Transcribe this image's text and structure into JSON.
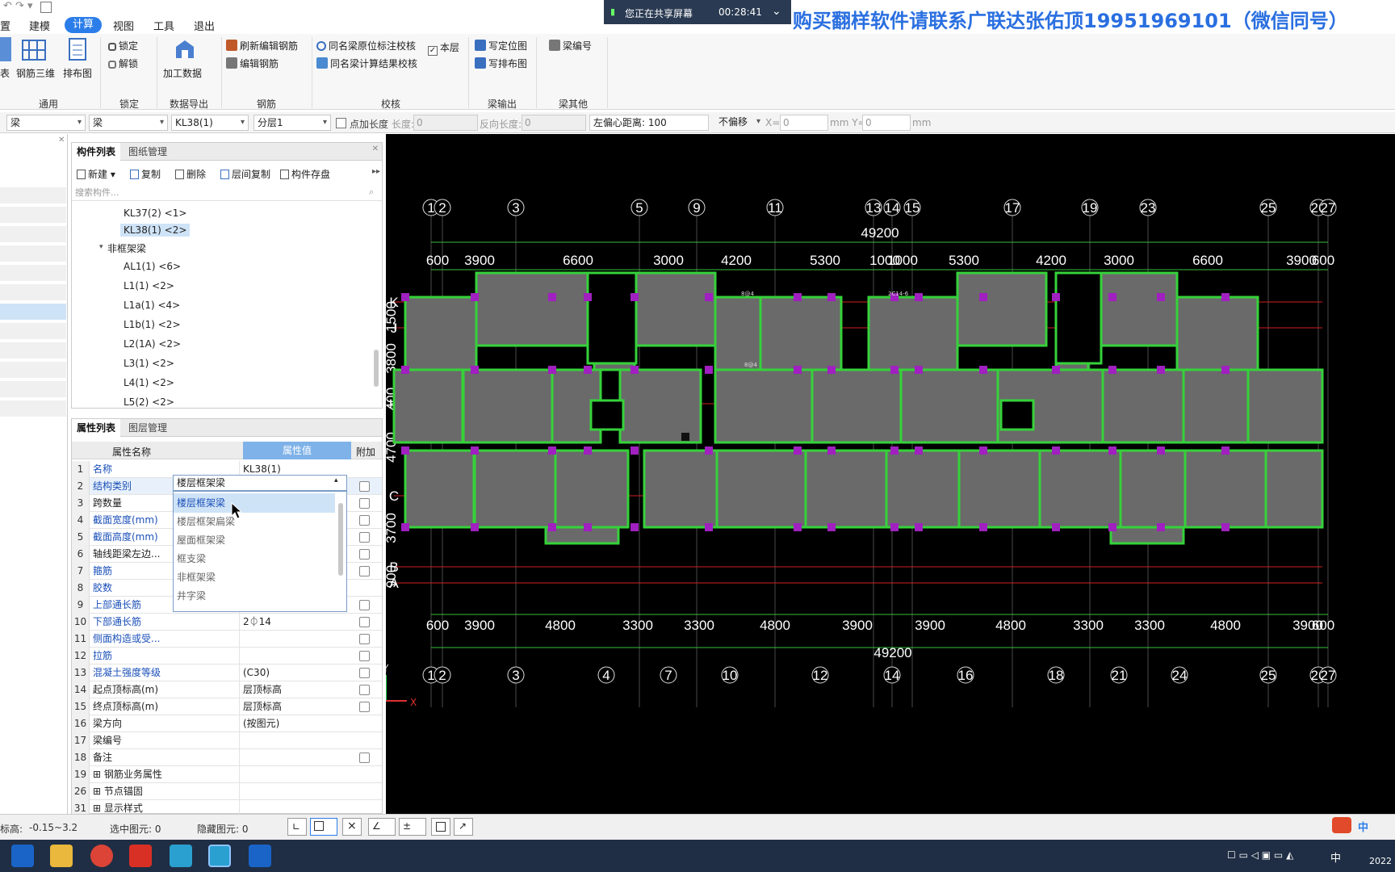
{
  "menubar": {
    "items": [
      "置",
      "建模",
      "计算",
      "视图",
      "工具",
      "退出"
    ],
    "active": "计算"
  },
  "share": {
    "text": "您正在共享屏幕",
    "time": "00:28:41"
  },
  "banner": "购买翻样软件请联系广联达张佑顶19951969101（微信同号）",
  "ribbon": {
    "general": {
      "b1": "表",
      "b2": "钢筋三维",
      "b3": "排布图",
      "group": "通用"
    },
    "lock": {
      "lock": "锁定",
      "unlock": "解锁",
      "group": "锁定"
    },
    "export": {
      "btn": "加工数据",
      "group": "数据导出"
    },
    "rebar": {
      "refresh": "刷新编辑钢筋",
      "edit": "编辑钢筋",
      "group": "钢筋"
    },
    "check": {
      "b1": "同名梁原位标注校核",
      "b2": "同名梁计算结果校核",
      "thislayer": "本层",
      "group": "校核"
    },
    "output": {
      "b1": "写定位图",
      "b2": "写排布图",
      "group": "梁输出"
    },
    "other": {
      "b1": "梁编号",
      "group": "梁其他"
    }
  },
  "toolbar": {
    "sel1": "梁",
    "sel2": "梁",
    "sel3": "KL38(1)",
    "sel4": "分层1",
    "pt_len_label": "点加长度",
    "len_label": "长度:",
    "len_value": "0",
    "rev_len_label": "反向长度:",
    "rev_len_value": "0",
    "offset_label": "左偏心距离: 100",
    "no_offset": "不偏移",
    "x_label": "X=",
    "x_value": "0",
    "y_label": "mm Y=",
    "y_value": "0",
    "mm": "mm"
  },
  "complist": {
    "tab1": "构件列表",
    "tab2": "图纸管理",
    "new": "新建",
    "copy": "复制",
    "delete": "删除",
    "layer_copy": "层间复制",
    "store": "构件存盘",
    "search_placeholder": "搜索构件...",
    "items": [
      "KL37(2) <1>",
      "KL38(1) <2>",
      "非框架梁",
      "AL1(1) <6>",
      "L1(1) <2>",
      "L1a(1) <4>",
      "L1b(1) <2>",
      "L2(1A) <2>",
      "L3(1) <2>",
      "L4(1) <2>",
      "L5(2) <2>"
    ],
    "selected": "KL38(1) <2>"
  },
  "props": {
    "tab1": "属性列表",
    "tab2": "图层管理",
    "col_name": "属性名称",
    "col_value": "属性值",
    "col_extra": "附加",
    "rows": [
      {
        "n": "1",
        "name": "名称",
        "value": "KL38(1)",
        "blue": true,
        "chk": false
      },
      {
        "n": "2",
        "name": "结构类别",
        "value": "楼层框架梁",
        "blue": true,
        "chk": true
      },
      {
        "n": "3",
        "name": "跨数量",
        "value": "",
        "blue": false,
        "chk": true
      },
      {
        "n": "4",
        "name": "截面宽度(mm)",
        "value": "",
        "blue": true,
        "chk": true
      },
      {
        "n": "5",
        "name": "截面高度(mm)",
        "value": "",
        "blue": true,
        "chk": true
      },
      {
        "n": "6",
        "name": "轴线距梁左边...",
        "value": "",
        "blue": false,
        "chk": true
      },
      {
        "n": "7",
        "name": "箍筋",
        "value": "",
        "blue": true,
        "chk": true
      },
      {
        "n": "8",
        "name": "胶数",
        "value": "",
        "blue": true,
        "chk": false
      },
      {
        "n": "9",
        "name": "上部通长筋",
        "value": "",
        "blue": true,
        "chk": true
      },
      {
        "n": "10",
        "name": "下部通长筋",
        "value": "2⏀14",
        "blue": true,
        "chk": true
      },
      {
        "n": "11",
        "name": "侧面构造或受...",
        "value": "",
        "blue": true,
        "chk": true
      },
      {
        "n": "12",
        "name": "拉筋",
        "value": "",
        "blue": true,
        "chk": true
      },
      {
        "n": "13",
        "name": "混凝土强度等级",
        "value": "(C30)",
        "blue": true,
        "chk": true
      },
      {
        "n": "14",
        "name": "起点顶标高(m)",
        "value": "层顶标高",
        "blue": false,
        "chk": true
      },
      {
        "n": "15",
        "name": "终点顶标高(m)",
        "value": "层顶标高",
        "blue": false,
        "chk": true
      },
      {
        "n": "16",
        "name": "梁方向",
        "value": "(按图元)",
        "blue": false,
        "chk": false
      },
      {
        "n": "17",
        "name": "梁编号",
        "value": "",
        "blue": false,
        "chk": false
      },
      {
        "n": "18",
        "name": "备注",
        "value": "",
        "blue": false,
        "chk": true
      },
      {
        "n": "19",
        "name": "⊞ 钢筋业务属性",
        "value": "",
        "blue": false,
        "chk": false
      },
      {
        "n": "26",
        "name": "⊞ 节点锚固",
        "value": "",
        "blue": false,
        "chk": false
      },
      {
        "n": "31",
        "name": "⊞ 显示样式",
        "value": "",
        "blue": false,
        "chk": false
      }
    ]
  },
  "dropdown": {
    "options": [
      "楼层框架梁",
      "楼层框架扁梁",
      "屋面框架梁",
      "框支梁",
      "非框架梁",
      "井字梁"
    ],
    "highlighted": "楼层框架梁"
  },
  "drawing": {
    "top_axes": [
      "1",
      "2",
      "3",
      "5",
      "9",
      "11",
      "13",
      "14",
      "15",
      "17",
      "19",
      "23",
      "25",
      "26",
      "27"
    ],
    "bottom_axes": [
      "1",
      "2",
      "3",
      "4",
      "7",
      "10",
      "12",
      "14",
      "16",
      "18",
      "21",
      "24",
      "25",
      "26",
      "27"
    ],
    "total_dim": "49200",
    "top_dims": [
      "600",
      "3900",
      "6600",
      "3000",
      "4200",
      "5300",
      "1000",
      "1000",
      "5300",
      "4200",
      "3000",
      "6600",
      "3900",
      "600"
    ],
    "bottom_dims": [
      "600",
      "3900",
      "4800",
      "3300",
      "3300",
      "4800",
      "3900",
      "3900",
      "4800",
      "3300",
      "3300",
      "4800",
      "3900",
      "600"
    ],
    "left_axes": [
      "K",
      "J",
      "H",
      "C",
      "B",
      "A"
    ],
    "left_dims": [
      "1500",
      "3800",
      "400",
      "4700",
      "3700",
      "900"
    ],
    "tiny_labels": [
      "8@4",
      "2C14-6",
      "8@4"
    ],
    "axis_x": "X",
    "axis_y": "Y"
  },
  "status": {
    "elevation_label": "标高:",
    "elevation": "-0.15~3.2",
    "selected": "选中图元: 0",
    "hidden": "隐藏图元: 0"
  },
  "tray": {
    "ime": "中",
    "year": "2022"
  },
  "colors": {
    "accent": "#2b7de9",
    "beam": "#35d23a",
    "column": "#a020c0",
    "slab": "#6a6a6a",
    "axis_red": "#d02020"
  }
}
